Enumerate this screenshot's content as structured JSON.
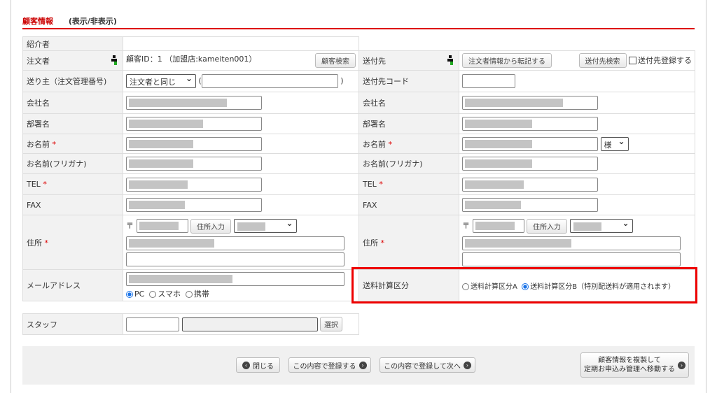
{
  "section": {
    "title": "顧客情報",
    "toggle": "(表示/非表示)"
  },
  "left": {
    "referrer": "紹介者",
    "orderer": "注文者",
    "customer_id": "顧客ID：1 （加盟店:kameiten001）",
    "customer_search": "顧客検索",
    "sender": "送り主（注文管理番号)",
    "sender_select": "注文者と同じ",
    "paren_open": "(",
    "paren_close": ")",
    "company": "会社名",
    "dept": "部署名",
    "name": "お名前",
    "kana": "お名前(フリガナ)",
    "tel": "TEL",
    "fax": "FAX",
    "address": "住所",
    "zip_mark": "〒",
    "address_input": "住所入力",
    "email": "メールアドレス",
    "email_types": [
      "PC",
      "スマホ",
      "携帯"
    ],
    "email_type_selected": "PC",
    "required": "*"
  },
  "right": {
    "dest": "送付先",
    "copy_btn": "注文者情報から転記する",
    "dest_search": "送付先検索",
    "dest_register": "送付先登録する",
    "dest_code": "送付先コード",
    "company": "会社名",
    "dept": "部署名",
    "name": "お名前",
    "honorific": "様",
    "kana": "お名前(フリガナ)",
    "tel": "TEL",
    "fax": "FAX",
    "address": "住所",
    "zip_mark": "〒",
    "address_input": "住所入力",
    "shipping": "送料計算区分",
    "shipping_a": "送料計算区分A",
    "shipping_b": "送料計算区分B（特別配送料が適用されます）",
    "shipping_selected": "B"
  },
  "staff": {
    "label": "スタッフ",
    "select": "選択"
  },
  "footer": {
    "close": "閉じる",
    "register": "この内容で登録する",
    "register_next": "この内容で登録して次へ",
    "copy_line1": "顧客情報を複製して",
    "copy_line2": "定期お申込み管理へ移動する"
  },
  "colors": {
    "accent": "#dd0000",
    "highlight": "#ee0000",
    "radio": "#1a73e8"
  }
}
